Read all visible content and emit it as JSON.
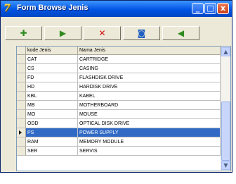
{
  "window": {
    "title": "Form Browse Jenis",
    "app_icon": "app-logo-icon",
    "controls": {
      "minimize": "_",
      "maximize": "□",
      "close": "x"
    }
  },
  "toolbar": {
    "buttons": [
      {
        "name": "add-record-button",
        "icon": "plus-icon",
        "glyph": "✚",
        "color": "#2e8b20"
      },
      {
        "name": "next-button",
        "icon": "forward-icon",
        "glyph": "▶",
        "color": "#2e8b20"
      },
      {
        "name": "delete-button",
        "icon": "x-icon",
        "glyph": "✕",
        "color": "#d01010"
      },
      {
        "name": "refresh-button",
        "icon": "window-icon",
        "glyph": "◙",
        "color": "#2060c0"
      },
      {
        "name": "exit-button",
        "icon": "exit-arrow-icon",
        "glyph": "◀",
        "color": "#2e8b20"
      }
    ]
  },
  "grid": {
    "columns": [
      "kode Jenis",
      "Nama Jenis"
    ],
    "rows": [
      {
        "kode": "CAT",
        "nama": "CARTRIDGE"
      },
      {
        "kode": "CS",
        "nama": "CASING"
      },
      {
        "kode": "FD",
        "nama": "FLASHDISK DRIVE"
      },
      {
        "kode": "HD",
        "nama": "HARDISK DRIVE"
      },
      {
        "kode": "KBL",
        "nama": "KABEL"
      },
      {
        "kode": "MB",
        "nama": "MOTHERBOARD"
      },
      {
        "kode": "MO",
        "nama": "MOUSE"
      },
      {
        "kode": "ODD",
        "nama": "OPTICAL DISK DRIVE"
      },
      {
        "kode": "PS",
        "nama": "POWER SUPPLY",
        "selected": true
      },
      {
        "kode": "RAM",
        "nama": "MEMORY MODULE"
      },
      {
        "kode": "SER",
        "nama": "SERVIS"
      }
    ],
    "selection_color": "#316ac5"
  },
  "scrollbar": {
    "up": "▲",
    "down": "▼"
  }
}
